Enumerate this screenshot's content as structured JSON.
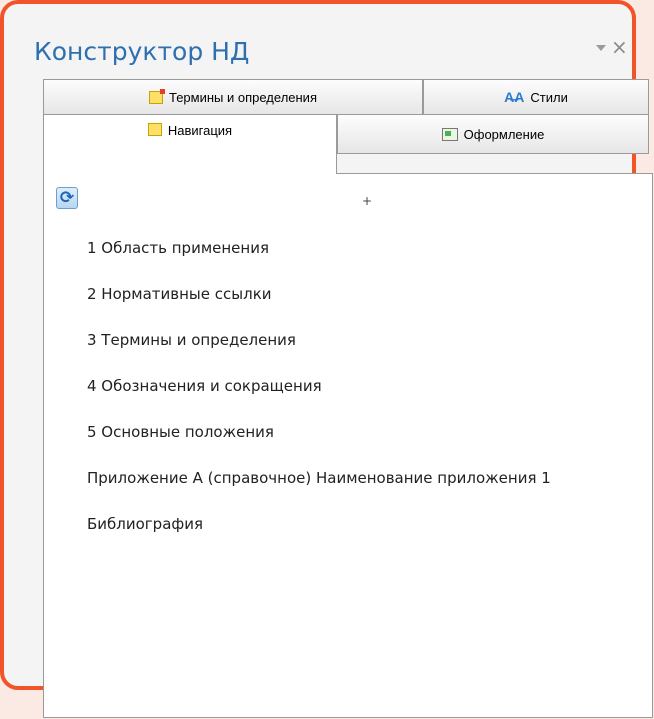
{
  "panel": {
    "title": "Конструктор НД",
    "close_glyph": "×"
  },
  "tabs": {
    "row1": [
      {
        "label": "Термины и определения",
        "icon": "note-icon"
      },
      {
        "label": "Стили",
        "icon": "styles-icon"
      }
    ],
    "row2": [
      {
        "label": "Навигация",
        "icon": "note-icon",
        "active": true
      },
      {
        "label": "Оформление",
        "icon": "format-icon"
      }
    ]
  },
  "toolbar": {
    "refresh_icon": "refresh-icon",
    "plus_glyph": "+"
  },
  "navigation": {
    "items": [
      "1 Область применения",
      "2 Нормативные ссылки",
      "3 Термины и определения",
      "4 Обозначения и сокращения",
      "5 Основные положения",
      "Приложение А (справочное) Наименование приложения 1",
      "Библиография"
    ]
  },
  "colors": {
    "accent_border": "#f2542a",
    "title_color": "#2e6fb0"
  }
}
